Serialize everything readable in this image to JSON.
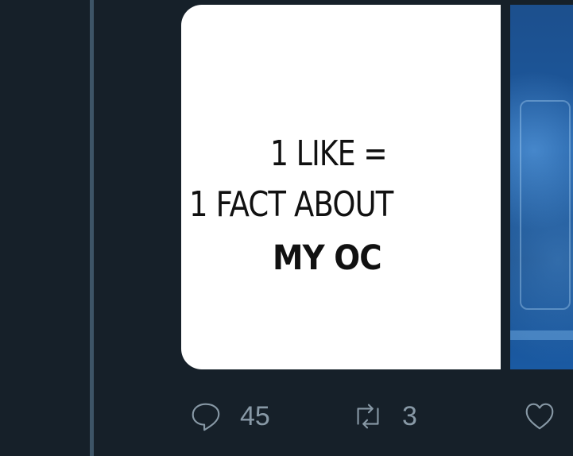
{
  "tweet": {
    "media": {
      "primary_image": {
        "lines": [
          "1 LIKE =",
          "1 FACT ABOUT",
          "MY OC"
        ]
      }
    },
    "actions": {
      "reply_count": "45",
      "retweet_count": "3"
    }
  },
  "icons": {
    "reply": "reply-icon",
    "retweet": "retweet-icon",
    "like": "like-icon"
  },
  "colors": {
    "background": "#162029",
    "thread_line": "#3d5466",
    "action_gray": "#8899a6",
    "image_background": "#ffffff",
    "secondary_image_blue": "#1d5aa0"
  }
}
